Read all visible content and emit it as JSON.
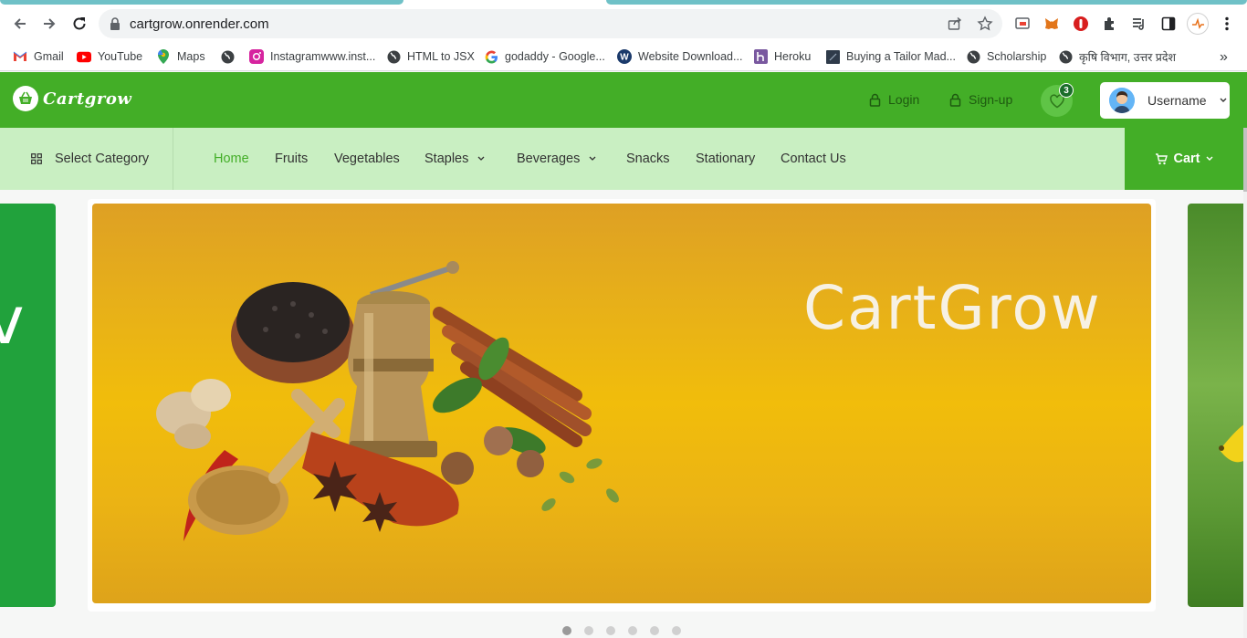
{
  "browser": {
    "url": "cartgrow.onrender.com",
    "bookmarks": [
      {
        "label": "Gmail",
        "icon": "gmail-icon"
      },
      {
        "label": "YouTube",
        "icon": "youtube-icon"
      },
      {
        "label": "Maps",
        "icon": "maps-icon"
      },
      {
        "label": "",
        "icon": "globe-icon"
      },
      {
        "label": "Instagramwww.inst...",
        "icon": "instagram-icon"
      },
      {
        "label": "HTML to JSX",
        "icon": "globe-icon"
      },
      {
        "label": "godaddy - Google...",
        "icon": "google-icon"
      },
      {
        "label": "Website Download...",
        "icon": "w-icon"
      },
      {
        "label": "Heroku",
        "icon": "heroku-icon"
      },
      {
        "label": "Buying a Tailor Mad...",
        "icon": "page-icon"
      },
      {
        "label": "Scholarship",
        "icon": "globe-icon"
      },
      {
        "label": "कृषि विभाग, उत्तर प्रदेश",
        "icon": "globe-icon"
      }
    ],
    "more": "»"
  },
  "header": {
    "brand": "Cartgrow",
    "login": "Login",
    "signup": "Sign-up",
    "wishlist_count": "3",
    "username": "Username",
    "colors": {
      "green": "#43ae27",
      "light_green": "#c9efc2"
    }
  },
  "catnav": {
    "select_category": "Select Category",
    "items": [
      {
        "label": "Home",
        "active": true
      },
      {
        "label": "Fruits"
      },
      {
        "label": "Vegetables"
      },
      {
        "label": "Staples",
        "dropdown": true
      },
      {
        "label": "Beverages",
        "dropdown": true
      },
      {
        "label": "Snacks"
      },
      {
        "label": "Stationary"
      },
      {
        "label": "Contact Us"
      }
    ],
    "cart": "Cart"
  },
  "carousel": {
    "prev_slide_text": "v",
    "title": "CartGrow",
    "dots": 6,
    "active_dot": 1
  }
}
